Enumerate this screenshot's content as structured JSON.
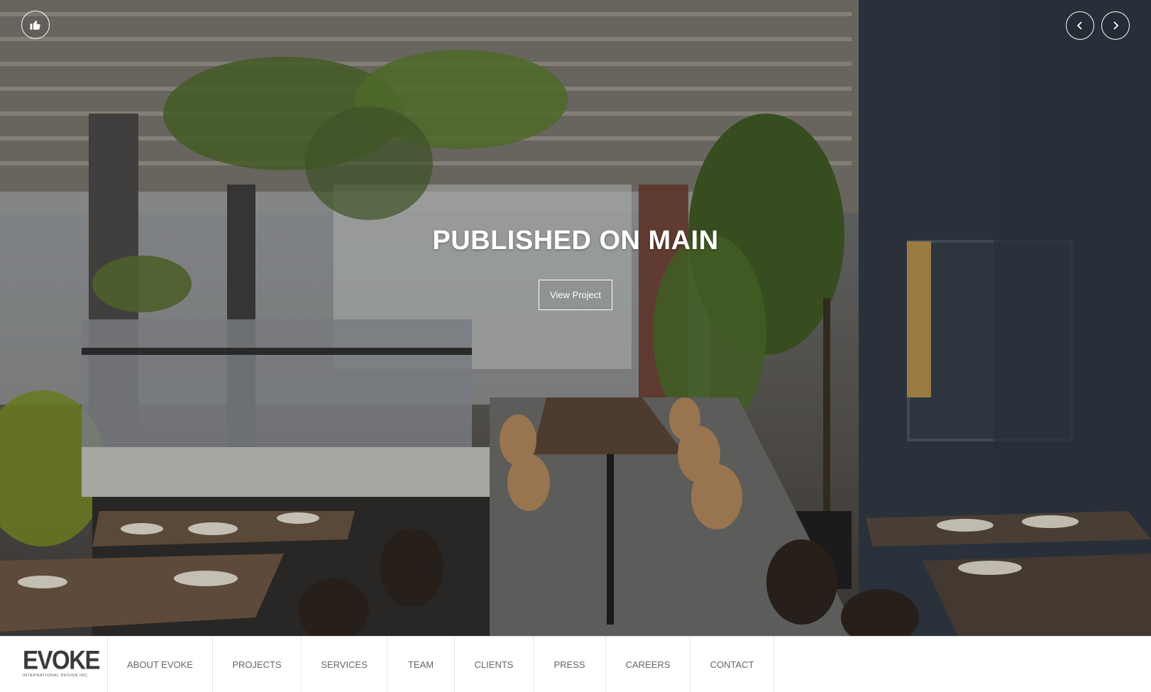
{
  "hero": {
    "title": "PUBLISHED ON MAIN",
    "button_label": "View Project",
    "image_description_icon": "restaurant-interior-photo"
  },
  "controls": {
    "like_icon": "thumbs-up-icon",
    "prev_icon": "chevron-left-icon",
    "next_icon": "chevron-right-icon"
  },
  "nav": {
    "logo_text": "EVOKE",
    "logo_subtext": "INTERNATIONAL DESIGN INC.",
    "items": [
      {
        "label": "ABOUT EVOKE"
      },
      {
        "label": "PROJECTS"
      },
      {
        "label": "SERVICES"
      },
      {
        "label": "TEAM"
      },
      {
        "label": "CLIENTS"
      },
      {
        "label": "PRESS"
      },
      {
        "label": "CAREERS"
      },
      {
        "label": "CONTACT"
      }
    ]
  },
  "colors": {
    "nav_text": "#666666",
    "nav_background": "#ffffff",
    "hero_text": "#ffffff"
  }
}
